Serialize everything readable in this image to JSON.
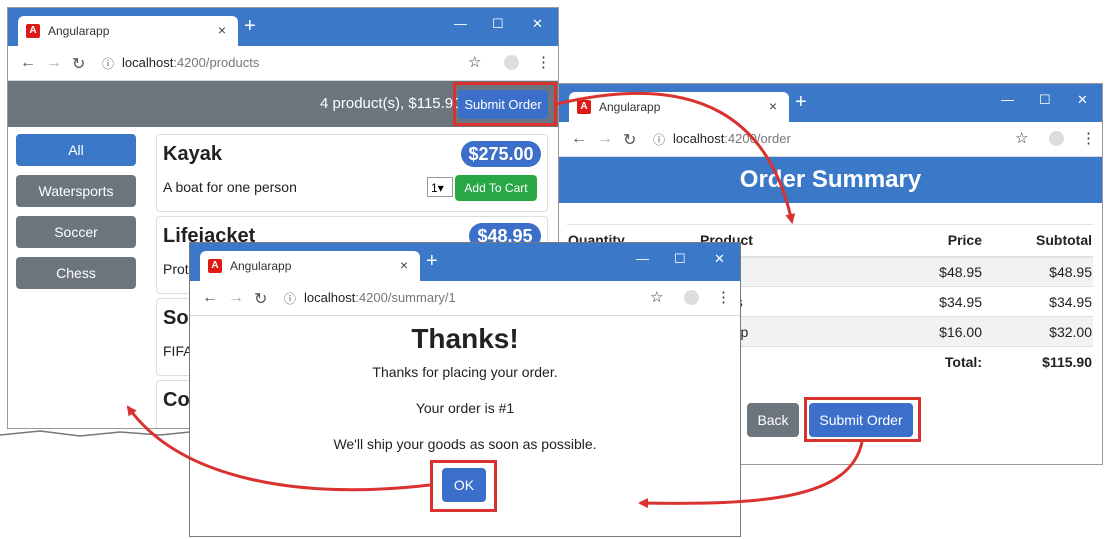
{
  "colors": {
    "brand_blue": "#3b78c8",
    "header_gray": "#6c757d",
    "success": "#28a745",
    "arrow_red": "#d9322f"
  },
  "products_window": {
    "tab_title": "Angularapp",
    "url_host": "localhost",
    "url_rest": ":4200/products",
    "header_summary": "4 product(s), $115.90",
    "submit_label": "Submit Order",
    "categories": [
      "All",
      "Watersports",
      "Soccer",
      "Chess"
    ],
    "products": [
      {
        "name": "Kayak",
        "price": "$275.00",
        "desc": "A boat for one person",
        "qty": "1",
        "add_label": "Add To Cart"
      },
      {
        "name": "Lifejacket",
        "price": "$48.95",
        "desc": "Prot"
      },
      {
        "name": "Soc",
        "desc": "FIFA"
      },
      {
        "name": "Co",
        "desc": ""
      }
    ]
  },
  "order_window": {
    "tab_title": "Angularapp",
    "url_host": "localhost",
    "url_rest": ":4200/order",
    "heading": "Order Summary",
    "columns": [
      "Quantity",
      "Product",
      "Price",
      "Subtotal"
    ],
    "rows": [
      {
        "qty": "",
        "product": "cket",
        "price": "$48.95",
        "subtotal": "$48.95"
      },
      {
        "qty": "",
        "product": "r Flags",
        "price": "$34.95",
        "subtotal": "$34.95"
      },
      {
        "qty": "",
        "product": "ing Cap",
        "price": "$16.00",
        "subtotal": "$32.00"
      }
    ],
    "total_label": "Total:",
    "total_value": "$115.90",
    "back_label": "Back",
    "submit_label": "Submit Order"
  },
  "summary_window": {
    "tab_title": "Angularapp",
    "url_host": "localhost",
    "url_rest": ":4200/summary/1",
    "heading": "Thanks!",
    "line1": "Thanks for placing your order.",
    "line2": "Your order is #1",
    "line3": "We'll ship your goods as soon as possible.",
    "ok_label": "OK"
  }
}
